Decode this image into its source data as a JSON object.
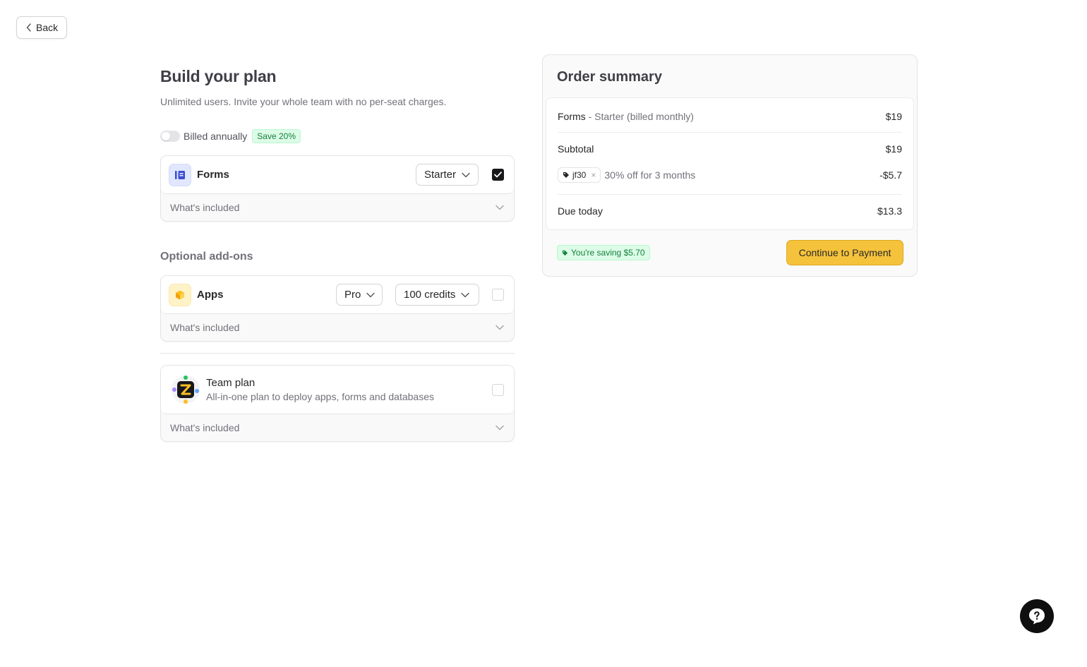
{
  "back": {
    "label": "Back"
  },
  "plan": {
    "title": "Build your plan",
    "subtitle": "Unlimited users. Invite your whole team with no per-seat charges.",
    "billing_label": "Billed annually",
    "billed_annually": false,
    "save_badge": "Save 20%"
  },
  "products": {
    "forms": {
      "name": "Forms",
      "tier": "Starter",
      "checked": true,
      "included_label": "What's included"
    }
  },
  "addons": {
    "title": "Optional add-ons",
    "apps": {
      "name": "Apps",
      "tier": "Pro",
      "credits": "100 credits",
      "checked": false,
      "included_label": "What's included"
    },
    "team": {
      "name": "Team plan",
      "description": "All-in-one plan to deploy apps, forms and databases",
      "checked": false,
      "included_label": "What's included"
    }
  },
  "summary": {
    "title": "Order summary",
    "line_item": {
      "product": "Forms",
      "separator": "-",
      "detail": "Starter (billed monthly)",
      "price": "$19"
    },
    "subtotal": {
      "label": "Subtotal",
      "value": "$19"
    },
    "coupon": {
      "code": "jf30",
      "remove": "×",
      "description": "30% off for 3 months",
      "value": "-$5.7"
    },
    "due": {
      "label": "Due today",
      "value": "$13.3"
    },
    "saving_badge": "You're saving $5.70",
    "pay_button": "Continue to Payment"
  },
  "colors": {
    "accent": "#f5c33b",
    "success": "#15803d",
    "success_bg": "#dcfce7"
  },
  "icons": {
    "help": "help-question-icon",
    "forms": "forms-icon",
    "apps": "apps-icon",
    "team": "team-plan-icon"
  }
}
